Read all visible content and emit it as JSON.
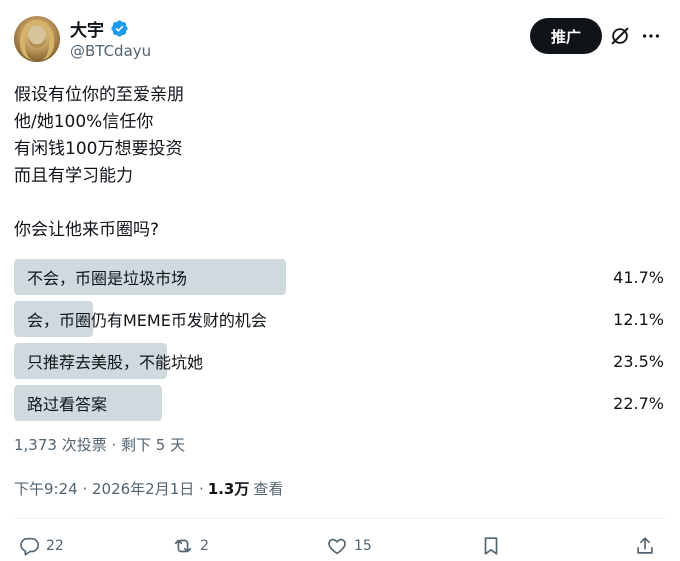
{
  "author": {
    "name": "大宇",
    "handle": "@BTCdayu"
  },
  "header": {
    "promote_label": "推广"
  },
  "tweet": {
    "lines": [
      "假设有位你的至爱亲朋",
      "他/她100%信任你",
      "有闲钱100万想要投资",
      "而且有学习能力"
    ],
    "question": "你会让他来币圈吗?"
  },
  "poll": {
    "options": [
      {
        "label": "不会，币圈是垃圾市场",
        "percent_text": "41.7%",
        "percent": 41.7
      },
      {
        "label": "会，币圈仍有MEME币发财的机会",
        "percent_text": "12.1%",
        "percent": 12.1
      },
      {
        "label": "只推荐去美股，不能坑她",
        "percent_text": "23.5%",
        "percent": 23.5
      },
      {
        "label": "路过看答案",
        "percent_text": "22.7%",
        "percent": 22.7
      }
    ],
    "meta": "1,373 次投票 · 剩下 5 天"
  },
  "timestamp": {
    "time": "下午9:24 · 2026年2月1日 ·",
    "views_count": "1.3万",
    "views_label": "查看"
  },
  "actions": {
    "replies": "22",
    "reposts": "2",
    "likes": "15"
  },
  "colors": {
    "poll_bar": "#cfd9de",
    "verified": "#1d9bf0",
    "muted": "#536471"
  }
}
